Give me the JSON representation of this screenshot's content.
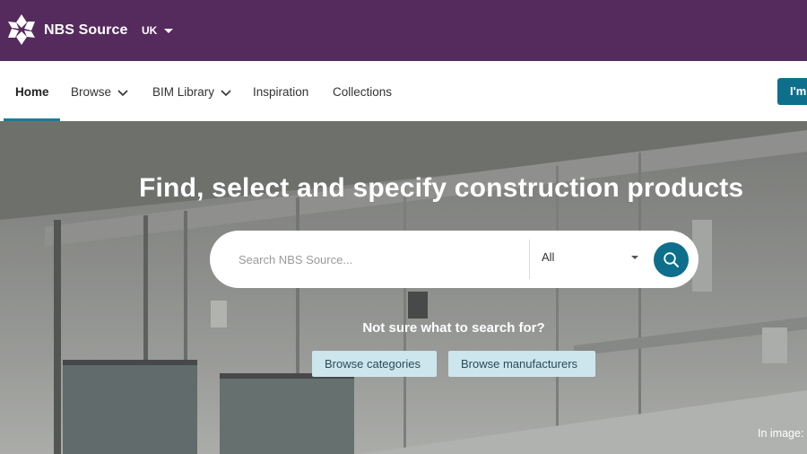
{
  "header": {
    "brand": "NBS Source",
    "region": "UK"
  },
  "nav": {
    "items": [
      {
        "label": "Home"
      },
      {
        "label": "Browse"
      },
      {
        "label": "BIM Library"
      },
      {
        "label": "Inspiration"
      },
      {
        "label": "Collections"
      }
    ],
    "cta_label": "I'm"
  },
  "hero": {
    "headline": "Find, select and specify construction products",
    "search_placeholder": "Search NBS Source...",
    "scope_selected": "All",
    "prompt": "Not sure what to search for?",
    "browse_categories": "Browse categories",
    "browse_manufacturers": "Browse manufacturers",
    "image_credit": "In image:"
  },
  "colors": {
    "header_bg": "#552a5c",
    "accent": "#0e6f8c",
    "chip_bg": "#cde6ee"
  },
  "icons": {
    "logo": "nbs-logo-icon",
    "search": "search-icon",
    "dropdown": "chevron-down-icon"
  }
}
